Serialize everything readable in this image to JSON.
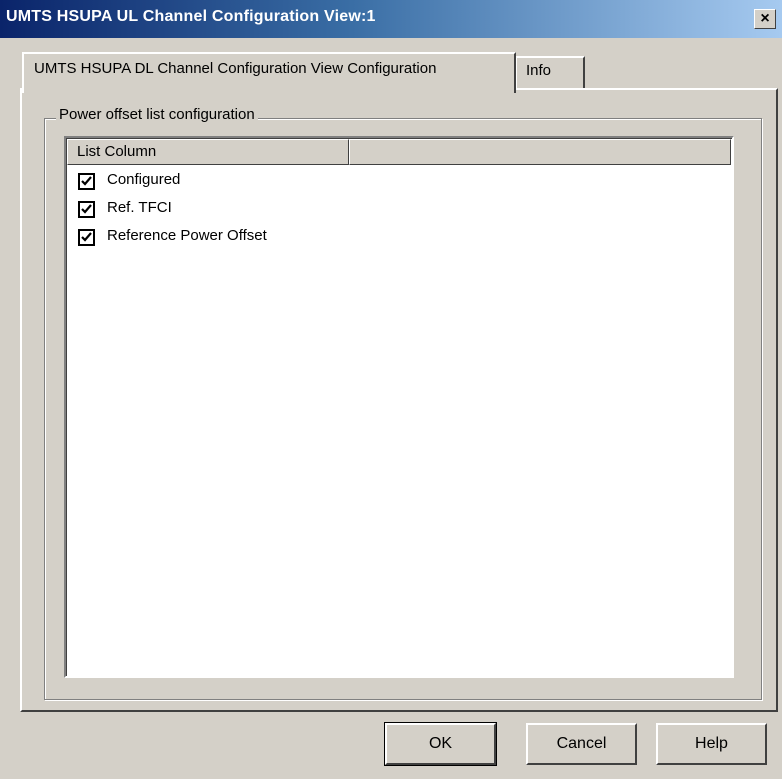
{
  "window": {
    "title": "UMTS HSUPA UL Channel Configuration View:1",
    "close_glyph": "×"
  },
  "tabs": [
    {
      "label": "UMTS HSUPA DL Channel Configuration View Configuration",
      "active": true
    },
    {
      "label": "Info",
      "active": false
    }
  ],
  "group": {
    "label": "Power offset list configuration"
  },
  "list": {
    "columns": [
      "List Column",
      ""
    ],
    "items": [
      {
        "label": "Configured",
        "checked": true
      },
      {
        "label": "Ref. TFCI",
        "checked": true
      },
      {
        "label": "Reference Power Offset",
        "checked": true
      }
    ]
  },
  "buttons": {
    "ok": "OK",
    "cancel": "Cancel",
    "help": "Help"
  },
  "icons": {
    "check": "checkmark-icon",
    "close": "close-icon"
  }
}
